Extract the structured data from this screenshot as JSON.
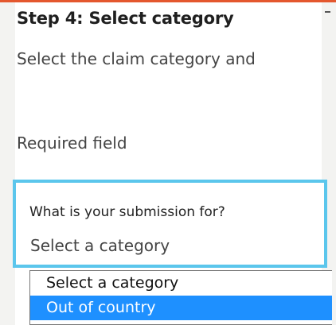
{
  "colors": {
    "accent_bar": "#e4572e",
    "focus_border": "#5bc6ec",
    "selected_option": "#1e90ff"
  },
  "step": {
    "heading": "Step 4: Select category",
    "description": "Select the claim category and"
  },
  "form": {
    "required_note": "Required field",
    "submission_field": {
      "label": "What is your submission for?",
      "value": "Select a category"
    }
  },
  "dropdown": {
    "options": [
      {
        "label": "Select a category",
        "selected": false
      },
      {
        "label": "Out of country",
        "selected": true
      }
    ]
  }
}
